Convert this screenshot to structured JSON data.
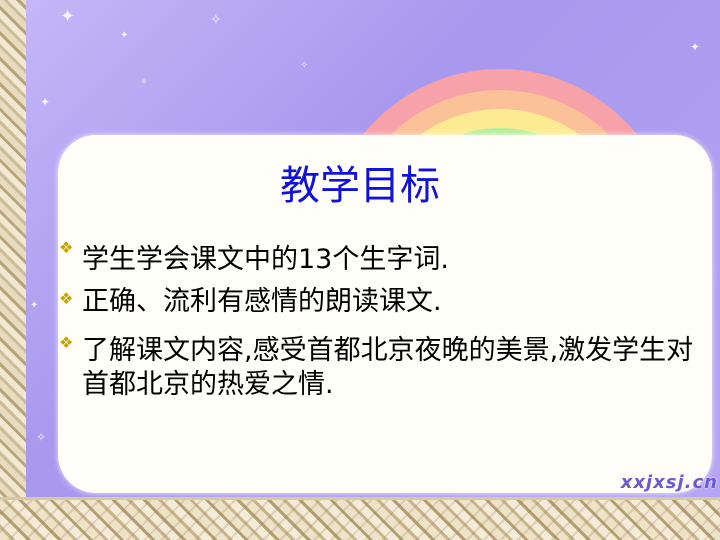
{
  "slide": {
    "title": "教学目标",
    "items": [
      {
        "text": "学生学会课文中的13个生字词."
      },
      {
        "text": "正确、流利有感情的朗读课文."
      },
      {
        "text": "了解课文内容,感受首都北京夜晚的美景,激发学生对首都北京的热爱之情."
      }
    ],
    "bullet_icon": "diamond-bullet-icon",
    "watermark": "xxjxsj.cn"
  },
  "colors": {
    "title": "#1111dd",
    "body_text": "#000000",
    "background": "#b9a9f0",
    "card": "#fffef9",
    "bullet": "#c8a200"
  }
}
